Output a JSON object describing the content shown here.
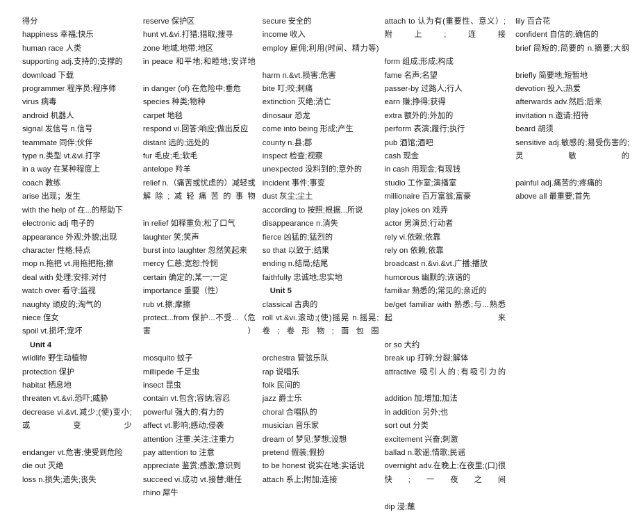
{
  "document": {
    "type": "vocabulary-glossary",
    "title": "English-Chinese Vocabulary List",
    "columns": [
      {
        "name": "column-1",
        "entries": [
          {
            "kind": "entry",
            "justify": false,
            "text": "得分"
          },
          {
            "kind": "entry",
            "justify": false,
            "text": "happiness  幸福;快乐"
          },
          {
            "kind": "entry",
            "justify": false,
            "text": "human race  人类"
          },
          {
            "kind": "entry",
            "justify": false,
            "text": "supporting adj.支持的;支撑的"
          },
          {
            "kind": "entry",
            "justify": false,
            "text": "download  下载"
          },
          {
            "kind": "entry",
            "justify": false,
            "text": "programmer  程序员;程序师"
          },
          {
            "kind": "entry",
            "justify": false,
            "text": "virus  病毒"
          },
          {
            "kind": "entry",
            "justify": false,
            "text": "android  机器人"
          },
          {
            "kind": "entry",
            "justify": false,
            "text": "signal  发信号  n.信号"
          },
          {
            "kind": "entry",
            "justify": false,
            "text": "teammate  同伴;伙伴"
          },
          {
            "kind": "entry",
            "justify": false,
            "text": "type n.类型  vt.&vi.打字"
          },
          {
            "kind": "entry",
            "justify": false,
            "text": "in a way  在某种程度上"
          },
          {
            "kind": "entry",
            "justify": false,
            "text": "coach  教练"
          },
          {
            "kind": "entry",
            "justify": false,
            "text": "arise  出现；发生"
          },
          {
            "kind": "entry",
            "justify": false,
            "text": "with the help of  在...的帮助下"
          },
          {
            "kind": "entry",
            "justify": false,
            "text": "electronic adj  电子的"
          },
          {
            "kind": "entry",
            "justify": false,
            "text": "appearance  外观;外貌;出现"
          },
          {
            "kind": "entry",
            "justify": false,
            "text": "character  性格;特点"
          },
          {
            "kind": "entry",
            "justify": false,
            "text": "mop n.拖把  vt.用拖把拖;擦"
          },
          {
            "kind": "entry",
            "justify": false,
            "text": "deal with  处理;安排;对付"
          },
          {
            "kind": "entry",
            "justify": false,
            "text": "watch over  看守;监视"
          },
          {
            "kind": "entry",
            "justify": false,
            "text": "naughty  顽皮的;淘气的"
          },
          {
            "kind": "entry",
            "justify": false,
            "text": "niece  侄女"
          },
          {
            "kind": "entry",
            "justify": false,
            "text": "spoil vt.损坏;宠坏"
          },
          {
            "kind": "unit",
            "justify": false,
            "text": "Unit 4"
          },
          {
            "kind": "entry",
            "justify": false,
            "text": "wildlife  野生动植物"
          },
          {
            "kind": "entry",
            "justify": false,
            "text": "protection  保护"
          },
          {
            "kind": "entry",
            "justify": false,
            "text": "habitat  栖息地"
          },
          {
            "kind": "entry",
            "justify": false,
            "text": "threaten vt.&vi.恐吓;威胁"
          },
          {
            "kind": "entry",
            "justify": true,
            "text": "decrease    vi.&vt.减少;(使)变小;或变少"
          },
          {
            "kind": "entry",
            "justify": false,
            "text": "endanger vt.危害;使受到危险"
          },
          {
            "kind": "entry",
            "justify": false,
            "text": "die out  灭绝"
          },
          {
            "kind": "entry",
            "justify": false,
            "text": "loss n.损失;遗失;丧失"
          }
        ]
      },
      {
        "name": "column-2",
        "entries": [
          {
            "kind": "entry",
            "justify": false,
            "text": "reserve  保护区"
          },
          {
            "kind": "entry",
            "justify": false,
            "text": "hunt vt.&vi.打猎;猎取;搜寻"
          },
          {
            "kind": "entry",
            "justify": false,
            "text": "zone  地域;地带;地区"
          },
          {
            "kind": "entry",
            "justify": true,
            "text": "in  peace   和平地;和睦地;安详地"
          },
          {
            "kind": "entry",
            "justify": false,
            "text": "in danger (of)  在危险中;垂危"
          },
          {
            "kind": "entry",
            "justify": false,
            "text": "species  种类;物种"
          },
          {
            "kind": "entry",
            "justify": false,
            "text": "carpet  地毯"
          },
          {
            "kind": "entry",
            "justify": false,
            "text": "respond vi.回答;响应;做出反应"
          },
          {
            "kind": "entry",
            "justify": false,
            "text": "distant  远的;远处的"
          },
          {
            "kind": "entry",
            "justify": false,
            "text": "fur  毛皮;毛;软毛"
          },
          {
            "kind": "entry",
            "justify": false,
            "text": "antelope  羚羊"
          },
          {
            "kind": "entry",
            "justify": true,
            "text": "relief  n.（痛苦或忧虑的）减轻或解除;减轻痛苦的事物"
          },
          {
            "kind": "entry",
            "justify": false,
            "text": "in relief  如释重负;松了口气"
          },
          {
            "kind": "entry",
            "justify": false,
            "text": "laughter  笑;笑声"
          },
          {
            "kind": "entry",
            "justify": false,
            "text": "burst into laughter  忽然笑起来"
          },
          {
            "kind": "entry",
            "justify": false,
            "text": "mercy  仁慈;宽恕;怜悯"
          },
          {
            "kind": "entry",
            "justify": false,
            "text": "certain  确定的;某一;一定"
          },
          {
            "kind": "entry",
            "justify": false,
            "text": "importance  重要（性）"
          },
          {
            "kind": "entry",
            "justify": false,
            "text": "rub vt.擦;摩擦"
          },
          {
            "kind": "entry",
            "justify": true,
            "text": "protect...from                保护...不受...（危害）"
          },
          {
            "kind": "entry",
            "justify": false,
            "text": "mosquito  蚊子"
          },
          {
            "kind": "entry",
            "justify": false,
            "text": "millipede  千足虫"
          },
          {
            "kind": "entry",
            "justify": false,
            "text": "insect  昆虫"
          },
          {
            "kind": "entry",
            "justify": false,
            "text": "contain vt.包含;容纳;容忍"
          },
          {
            "kind": "entry",
            "justify": false,
            "text": "powerful  强大的;有力的"
          },
          {
            "kind": "entry",
            "justify": false,
            "text": "affect vt.影响;感动;侵袭"
          },
          {
            "kind": "entry",
            "justify": false,
            "text": "attention  注重;关注;注重力"
          },
          {
            "kind": "entry",
            "justify": false,
            "text": "pay attention to  注意"
          },
          {
            "kind": "entry",
            "justify": false,
            "text": "appreciate  鉴赏;感激;意识到"
          },
          {
            "kind": "entry",
            "justify": false,
            "text": "succeed vi.成功  vt.接替;继任"
          },
          {
            "kind": "entry",
            "justify": false,
            "text": "rhino  犀牛"
          }
        ]
      },
      {
        "name": "column-3",
        "entries": [
          {
            "kind": "entry",
            "justify": false,
            "text": "secure  安全的"
          },
          {
            "kind": "entry",
            "justify": false,
            "text": "income  收入"
          },
          {
            "kind": "entry",
            "justify": true,
            "text": "employ   雇佣;利用(时间、精力等)"
          },
          {
            "kind": "entry",
            "justify": false,
            "text": "harm n.&vt.损害;危害"
          },
          {
            "kind": "entry",
            "justify": false,
            "text": "bite  叮;咬;刺痛"
          },
          {
            "kind": "entry",
            "justify": false,
            "text": "extinction  灭绝;消亡"
          },
          {
            "kind": "entry",
            "justify": false,
            "text": "dinosaur  恐龙"
          },
          {
            "kind": "entry",
            "justify": false,
            "text": "come into being  形成;产生"
          },
          {
            "kind": "entry",
            "justify": false,
            "text": "county n.县;郡"
          },
          {
            "kind": "entry",
            "justify": false,
            "text": "inspect  检查;视察"
          },
          {
            "kind": "entry",
            "justify": false,
            "text": "unexpected  没料到的;意外的"
          },
          {
            "kind": "entry",
            "justify": false,
            "text": "incident  事件;事变"
          },
          {
            "kind": "entry",
            "justify": false,
            "text": "dust  灰尘;尘土"
          },
          {
            "kind": "entry",
            "justify": false,
            "text": "according to  按照;根据...所说"
          },
          {
            "kind": "entry",
            "justify": false,
            "text": "disappearance n.消失"
          },
          {
            "kind": "entry",
            "justify": false,
            "text": "fierce  凶猛的;猛烈的"
          },
          {
            "kind": "entry",
            "justify": false,
            "text": "so that  以致于;结果"
          },
          {
            "kind": "entry",
            "justify": false,
            "text": "ending n.结局;结尾"
          },
          {
            "kind": "entry",
            "justify": false,
            "text": "faithfully  忠诚地;忠实地"
          },
          {
            "kind": "unit",
            "justify": false,
            "text": "Unit 5"
          },
          {
            "kind": "entry",
            "justify": false,
            "text": "classical  古典的"
          },
          {
            "kind": "entry",
            "justify": true,
            "text": "roll   vt.&vi.滚动;(使)摇晃   n.摇晃;卷;卷形物;面包圈"
          },
          {
            "kind": "entry",
            "justify": false,
            "text": "orchestra  管弦乐队"
          },
          {
            "kind": "entry",
            "justify": false,
            "text": "rap  说唱乐"
          },
          {
            "kind": "entry",
            "justify": false,
            "text": "folk  民间的"
          },
          {
            "kind": "entry",
            "justify": false,
            "text": "jazz  爵士乐"
          },
          {
            "kind": "entry",
            "justify": false,
            "text": "choral  合唱队的"
          },
          {
            "kind": "entry",
            "justify": false,
            "text": "musician  音乐家"
          },
          {
            "kind": "entry",
            "justify": false,
            "text": "dream of  梦见;梦想;设想"
          },
          {
            "kind": "entry",
            "justify": false,
            "text": "pretend  假装;假扮"
          },
          {
            "kind": "entry",
            "justify": false,
            "text": "to be honest  说实在地;实话说"
          },
          {
            "kind": "entry",
            "justify": false,
            "text": "attach  系上;附加;连接"
          }
        ]
      },
      {
        "name": "column-4",
        "entries": [
          {
            "kind": "entry",
            "justify": true,
            "text": "attach  to   认为有(重要性、意义）;附上;连接"
          },
          {
            "kind": "entry",
            "justify": false,
            "text": "form  组成;形成;构成"
          },
          {
            "kind": "entry",
            "justify": false,
            "text": "fame  名声;名望"
          },
          {
            "kind": "entry",
            "justify": false,
            "text": "passer-by  过路人;行人"
          },
          {
            "kind": "entry",
            "justify": false,
            "text": "earn  赚;挣得;获得"
          },
          {
            "kind": "entry",
            "justify": false,
            "text": "extra  额外的;外加的"
          },
          {
            "kind": "entry",
            "justify": false,
            "text": "perform  表演;履行;执行"
          },
          {
            "kind": "entry",
            "justify": false,
            "text": "pub  酒馆;酒吧"
          },
          {
            "kind": "entry",
            "justify": false,
            "text": "cash  现金"
          },
          {
            "kind": "entry",
            "justify": false,
            "text": "in cash  用现金;有现钱"
          },
          {
            "kind": "entry",
            "justify": false,
            "text": "studio  工作室;演播室"
          },
          {
            "kind": "entry",
            "justify": false,
            "text": "millionaire  百万富翁;富豪"
          },
          {
            "kind": "entry",
            "justify": false,
            "text": "play jokes on  戏弄"
          },
          {
            "kind": "entry",
            "justify": false,
            "text": "actor  男演员;行动者"
          },
          {
            "kind": "entry",
            "justify": false,
            "text": "rely vi.依赖;依靠"
          },
          {
            "kind": "entry",
            "justify": false,
            "text": "rely on  依赖;依靠"
          },
          {
            "kind": "entry",
            "justify": false,
            "text": "broadcast n.&vi.&vt.广播;播放"
          },
          {
            "kind": "entry",
            "justify": false,
            "text": "humorous  幽默的;诙谐的"
          },
          {
            "kind": "entry",
            "justify": false,
            "text": "familiar  熟悉的;常见的;亲近的"
          },
          {
            "kind": "entry",
            "justify": true,
            "text": "be/get  familiar  with   熟悉;与...熟悉起来"
          },
          {
            "kind": "entry",
            "justify": false,
            "text": "or so  大约"
          },
          {
            "kind": "entry",
            "justify": false,
            "text": "break up  打碎;分裂;解体"
          },
          {
            "kind": "entry",
            "justify": true,
            "text": "attractive    吸引人的;有吸引力的"
          },
          {
            "kind": "entry",
            "justify": false,
            "text": "addition  加;增加;加法"
          },
          {
            "kind": "entry",
            "justify": false,
            "text": "in addition  另外;也"
          },
          {
            "kind": "entry",
            "justify": false,
            "text": "sort out  分类"
          },
          {
            "kind": "entry",
            "justify": false,
            "text": "excitement  兴奋;刺激"
          },
          {
            "kind": "entry",
            "justify": false,
            "text": "ballad n.歌谣;情歌;民谣"
          },
          {
            "kind": "entry",
            "justify": true,
            "text": "overnight    adv.在晚上;在夜里;(口)很快;一夜之间"
          },
          {
            "kind": "entry",
            "justify": false,
            "text": "dip  浸;蘸"
          }
        ]
      },
      {
        "name": "column-5",
        "entries": [
          {
            "kind": "entry",
            "justify": false,
            "text": "lily  百合花"
          },
          {
            "kind": "entry",
            "justify": false,
            "text": "confident  自信的;确信的"
          },
          {
            "kind": "entry",
            "justify": true,
            "text": "brief  简短的;简要的  n.摘要;大纲"
          },
          {
            "kind": "entry",
            "justify": false,
            "text": "briefly  简要地;短暂地"
          },
          {
            "kind": "entry",
            "justify": false,
            "text": "devotion  投入;热爱"
          },
          {
            "kind": "entry",
            "justify": false,
            "text": "afterwards adv.然后;后来"
          },
          {
            "kind": "entry",
            "justify": false,
            "text": "invitation n.邀请;招待"
          },
          {
            "kind": "entry",
            "justify": false,
            "text": "beard  胡须"
          },
          {
            "kind": "entry",
            "justify": true,
            "text": "sensitive    adj.敏感的;易受伤害的;灵敏的"
          },
          {
            "kind": "entry",
            "justify": false,
            "text": "painful adj.痛苦的;疼痛的"
          },
          {
            "kind": "entry",
            "justify": false,
            "text": "above all  最重要;首先"
          }
        ]
      }
    ]
  }
}
